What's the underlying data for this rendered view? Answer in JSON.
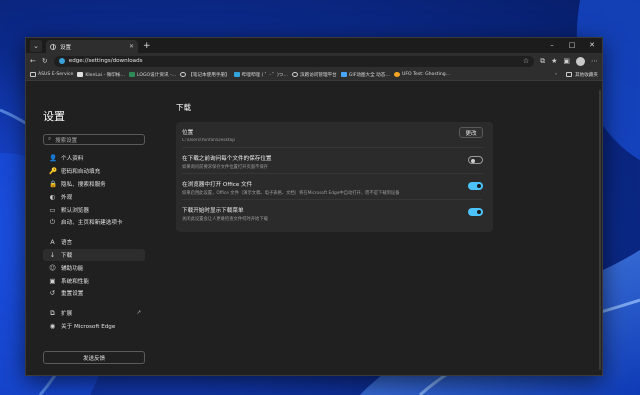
{
  "tab": {
    "title": "设置",
    "close": "✕",
    "new": "+"
  },
  "window_controls": {
    "minimize": "–",
    "maximize": "□",
    "close": "✕"
  },
  "address": {
    "url": "edge://settings/downloads"
  },
  "bookmarks": {
    "items": [
      {
        "label": "ASUS E-Service",
        "color": "#e6e6e6"
      },
      {
        "label": "KlenLai - 微印帐…",
        "color": "#e0e0e0"
      },
      {
        "label": "LOGO设计资讯 -…",
        "color": "#2e8b57"
      },
      {
        "label": "【笔记本使用手册】",
        "color": "#cfcfcf"
      },
      {
        "label": "哔哩哔哩 ( ゜- ゜)つ…",
        "color": "#33a3dc"
      },
      {
        "label": "滨跑访问管理平台",
        "color": "#1e90ff"
      },
      {
        "label": "GIF动图大全 动态…",
        "color": "#4aa3ff"
      },
      {
        "label": "UFO Test: Ghosting…",
        "color": "#f5a623"
      }
    ],
    "more": "›",
    "other_folder": "其他收藏夹"
  },
  "sidebar": {
    "title": "设置",
    "search_placeholder": "搜索设置",
    "items": [
      {
        "label": "个人资料",
        "icon": "👤"
      },
      {
        "label": "密码和自动填充",
        "icon": "🔑"
      },
      {
        "label": "隐私、搜索和服务",
        "icon": "🔒"
      },
      {
        "label": "外观",
        "icon": "◐"
      },
      {
        "label": "默认浏览器",
        "icon": "▭"
      },
      {
        "label": "启动、主页和新建选项卡",
        "icon": "⏻"
      },
      {
        "label": "语言",
        "icon": "A"
      },
      {
        "label": "下载",
        "icon": "↓"
      },
      {
        "label": "辅助功能",
        "icon": "☺"
      },
      {
        "label": "系统和性能",
        "icon": "▣"
      },
      {
        "label": "重置设置",
        "icon": "↺"
      },
      {
        "label": "扩展",
        "icon": "⧉"
      },
      {
        "label": "关于 Microsoft Edge",
        "icon": "◉"
      }
    ],
    "ext_link_icon": "↗",
    "feedback": "发送反馈"
  },
  "main": {
    "title": "下载",
    "rows": [
      {
        "title": "位置",
        "desc": "C:\\Users\\Yunfan\\Desktop",
        "button": "更改"
      },
      {
        "title": "在下载之前询问每个文件的保存位置",
        "desc": "如果询问前要求保存文件位置打开页面不保存",
        "state": "off"
      },
      {
        "title": "在浏览器中打开 Office 文件",
        "desc": "如果启用此设置，Office 文件（演示文稿、电子表格、文档）将在Microsoft Edge中自动打开，而不是下载到设备",
        "state": "on"
      },
      {
        "title": "下载开始时显示下载菜单",
        "desc": "关闭此设置会让人更难检查文件何时开始下载",
        "state": "on"
      }
    ]
  },
  "colors": {
    "accent": "#4cc2ff",
    "background": "#202020",
    "card": "#2b2b2b"
  }
}
